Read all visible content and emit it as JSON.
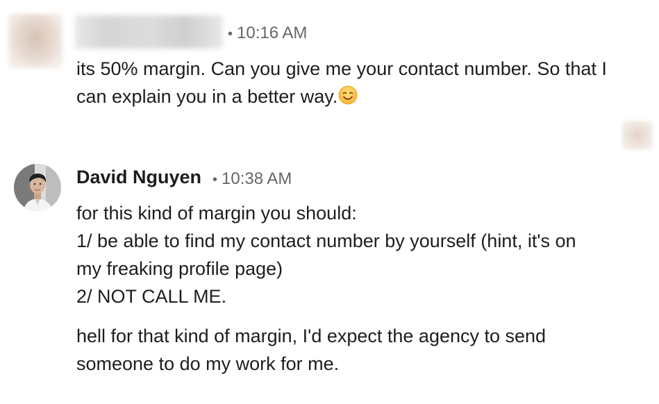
{
  "messages": [
    {
      "author": "",
      "time": "10:16 AM",
      "lines": [
        "its 50% margin. Can you give me your contact number. So that I",
        "can explain you in a better way."
      ]
    },
    {
      "author": "David Nguyen",
      "time": "10:38 AM",
      "lines": [
        "for this kind of margin you should:",
        "1/ be able to find my contact number by yourself (hint, it's on",
        "my freaking profile page)",
        "2/ NOT CALL ME."
      ],
      "followup_lines": [
        "hell for that kind of margin, I'd expect the agency to send",
        "someone to do my work for me."
      ]
    }
  ],
  "separator": "•",
  "icons": {
    "first_message_emoji": "smiling-face-icon",
    "read_receipt": "read-receipt-avatar-icon"
  }
}
